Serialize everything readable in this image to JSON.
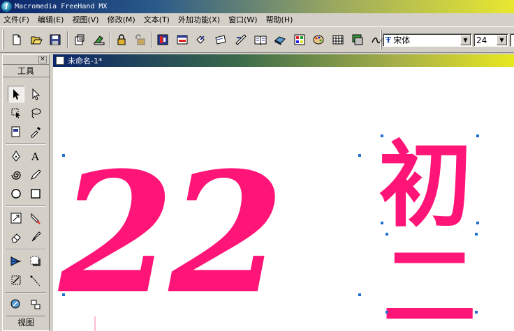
{
  "window": {
    "title": "Macromedia FreeHand MX"
  },
  "menu": [
    "文件(F)",
    "编辑(E)",
    "视图(V)",
    "修改(M)",
    "文本(T)",
    "外加功能(X)",
    "窗口(W)",
    "帮助(H)"
  ],
  "toolbar": {
    "buttons": [
      "new-icon",
      "open-icon",
      "save-icon",
      "import-icon",
      "export-icon",
      "lock-icon",
      "unlock-icon",
      "align-icon",
      "layers-icon",
      "transform-icon",
      "envelope-icon",
      "book-icon",
      "color-icon",
      "swatch-icon",
      "palette-icon",
      "grid-icon",
      "display-icon",
      "trace-icon"
    ],
    "font_name": "宋体",
    "font_size": "24"
  },
  "tools_panel": {
    "title": "工具",
    "view_label": "视图",
    "close": "×",
    "tools": [
      "pointer-icon",
      "subselect-icon",
      "lasso-icon",
      "freeform-lasso-icon",
      "page-icon",
      "eyedropper-icon",
      "pen-icon",
      "text-icon",
      "spiral-icon",
      "pencil-icon",
      "ellipse-icon",
      "rectangle-icon",
      "scale-icon",
      "knife-icon",
      "eraser-icon",
      "brush-icon",
      "gradient-icon",
      "shadow-icon",
      "trace-icon",
      "connector-icon",
      "zoom-icon",
      "hand-icon"
    ]
  },
  "document": {
    "title": "未命名-1*"
  },
  "artwork": {
    "numerals": "22",
    "char_1": "初",
    "char_2": "二",
    "fill_color": "#ff1477",
    "selection_color": "#1f6fd0"
  }
}
